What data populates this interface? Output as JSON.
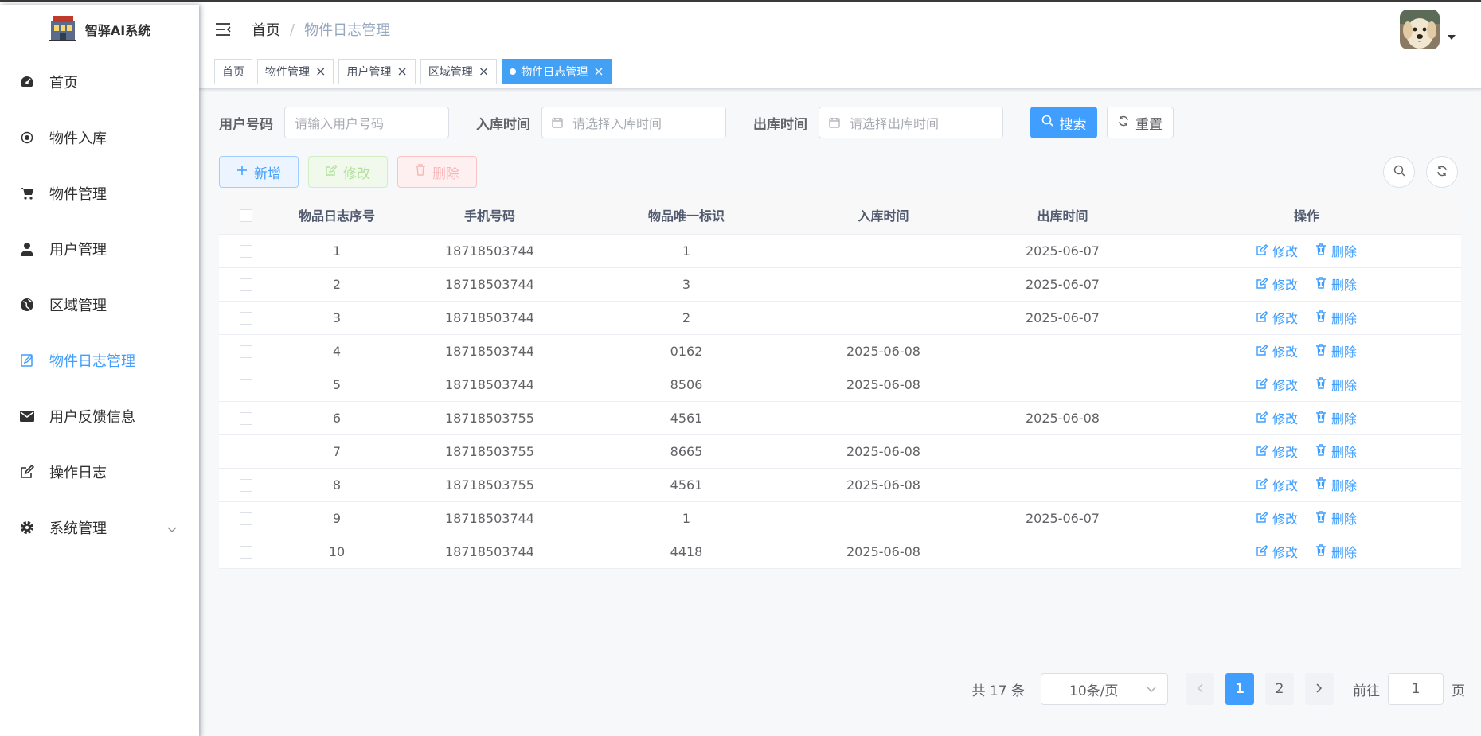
{
  "app": {
    "title": "智驿AI系统"
  },
  "sidebar": {
    "items": [
      {
        "label": "首页",
        "icon": "dashboard-icon"
      },
      {
        "label": "物件入库",
        "icon": "radio-icon"
      },
      {
        "label": "物件管理",
        "icon": "shopping-cart-icon"
      },
      {
        "label": "用户管理",
        "icon": "user-icon"
      },
      {
        "label": "区域管理",
        "icon": "globe-icon"
      },
      {
        "label": "物件日志管理",
        "icon": "edit-document-icon",
        "active": true
      },
      {
        "label": "用户反馈信息",
        "icon": "message-icon"
      },
      {
        "label": "操作日志",
        "icon": "edit-icon"
      },
      {
        "label": "系统管理",
        "icon": "gear-icon",
        "expandable": true
      }
    ]
  },
  "breadcrumb": {
    "home": "首页",
    "separator": "/",
    "current": "物件日志管理"
  },
  "tags": [
    {
      "label": "首页",
      "closable": false
    },
    {
      "label": "物件管理",
      "closable": true
    },
    {
      "label": "用户管理",
      "closable": true
    },
    {
      "label": "区域管理",
      "closable": true
    },
    {
      "label": "物件日志管理",
      "closable": true,
      "active": true
    }
  ],
  "search": {
    "user_label": "用户号码",
    "user_placeholder": "请输入用户号码",
    "in_label": "入库时间",
    "in_placeholder": "请选择入库时间",
    "out_label": "出库时间",
    "out_placeholder": "请选择出库时间",
    "search_btn": "搜索",
    "reset_btn": "重置"
  },
  "toolbar": {
    "add": "新增",
    "edit": "修改",
    "delete": "删除"
  },
  "table": {
    "headers": [
      "物品日志序号",
      "手机号码",
      "物品唯一标识",
      "入库时间",
      "出库时间",
      "操作"
    ],
    "row_actions": {
      "edit": "修改",
      "delete": "删除"
    },
    "rows": [
      {
        "id": "1",
        "phone": "18718503744",
        "uid": "1",
        "in": "",
        "out": "2025-06-07"
      },
      {
        "id": "2",
        "phone": "18718503744",
        "uid": "3",
        "in": "",
        "out": "2025-06-07"
      },
      {
        "id": "3",
        "phone": "18718503744",
        "uid": "2",
        "in": "",
        "out": "2025-06-07"
      },
      {
        "id": "4",
        "phone": "18718503744",
        "uid": "0162",
        "in": "2025-06-08",
        "out": ""
      },
      {
        "id": "5",
        "phone": "18718503744",
        "uid": "8506",
        "in": "2025-06-08",
        "out": ""
      },
      {
        "id": "6",
        "phone": "18718503755",
        "uid": "4561",
        "in": "",
        "out": "2025-06-08"
      },
      {
        "id": "7",
        "phone": "18718503755",
        "uid": "8665",
        "in": "2025-06-08",
        "out": ""
      },
      {
        "id": "8",
        "phone": "18718503755",
        "uid": "4561",
        "in": "2025-06-08",
        "out": ""
      },
      {
        "id": "9",
        "phone": "18718503744",
        "uid": "1",
        "in": "",
        "out": "2025-06-07"
      },
      {
        "id": "10",
        "phone": "18718503744",
        "uid": "4418",
        "in": "2025-06-08",
        "out": ""
      }
    ]
  },
  "pagination": {
    "total": "共 17 条",
    "page_size": "10条/页",
    "pages": [
      "1",
      "2"
    ],
    "current": "1",
    "goto_label": "前往",
    "goto_value": "1",
    "page_suffix": "页"
  },
  "colors": {
    "primary": "#409eff",
    "success_light": "#b3e19d",
    "danger_light": "#fab6b6"
  }
}
